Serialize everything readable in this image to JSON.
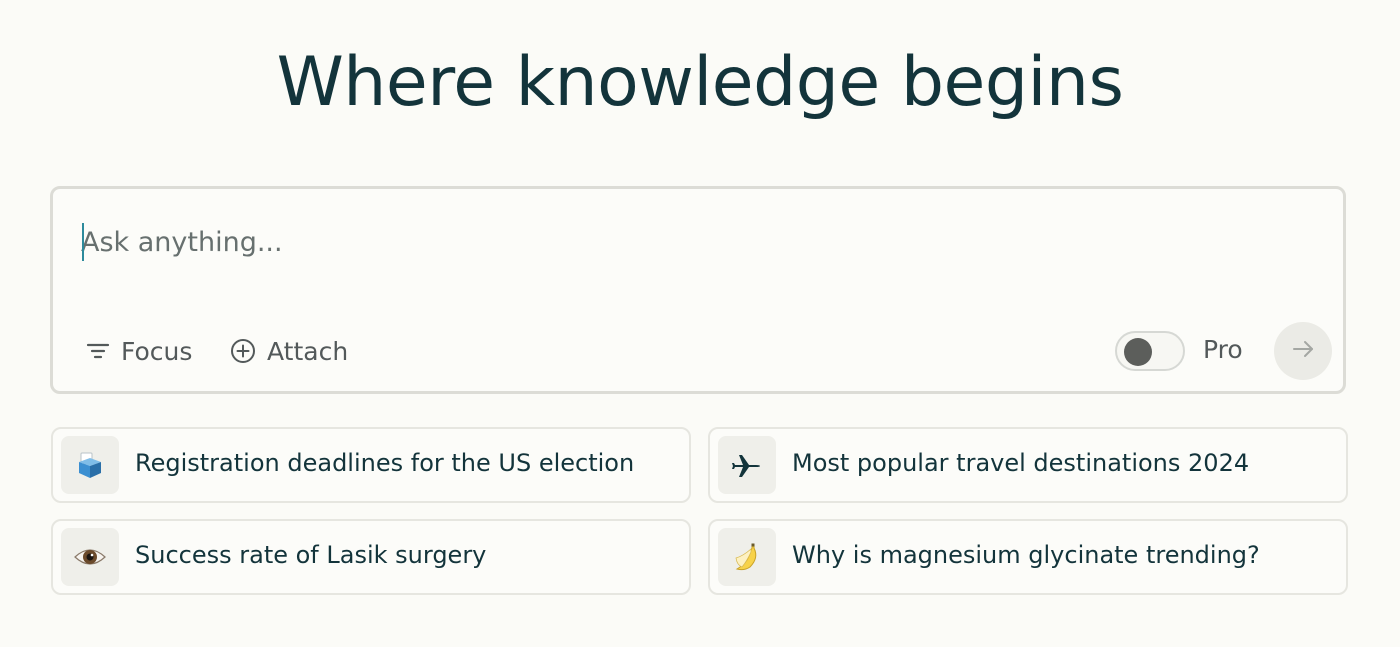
{
  "headline": "Where knowledge begins",
  "composer": {
    "placeholder": "Ask anything...",
    "value": "",
    "focus_label": "Focus",
    "attach_label": "Attach",
    "pro_label": "Pro",
    "pro_enabled": false,
    "focus_icon": "filter-lines-icon",
    "attach_icon": "plus-circle-icon",
    "submit_icon": "arrow-right-icon"
  },
  "suggestions": [
    {
      "icon": "ballot-box-icon",
      "label": "Registration deadlines for the US election"
    },
    {
      "icon": "airplane-icon",
      "label": "Most popular travel destinations 2024"
    },
    {
      "icon": "eye-icon",
      "label": "Success rate of Lasik surgery"
    },
    {
      "icon": "banana-icon",
      "label": "Why is magnesium glycinate trending?"
    }
  ],
  "colors": {
    "background": "#fbfbf7",
    "text": "#13343b",
    "muted": "#53595a",
    "border": "#dcdcd6",
    "caret": "#2d8a9c"
  }
}
